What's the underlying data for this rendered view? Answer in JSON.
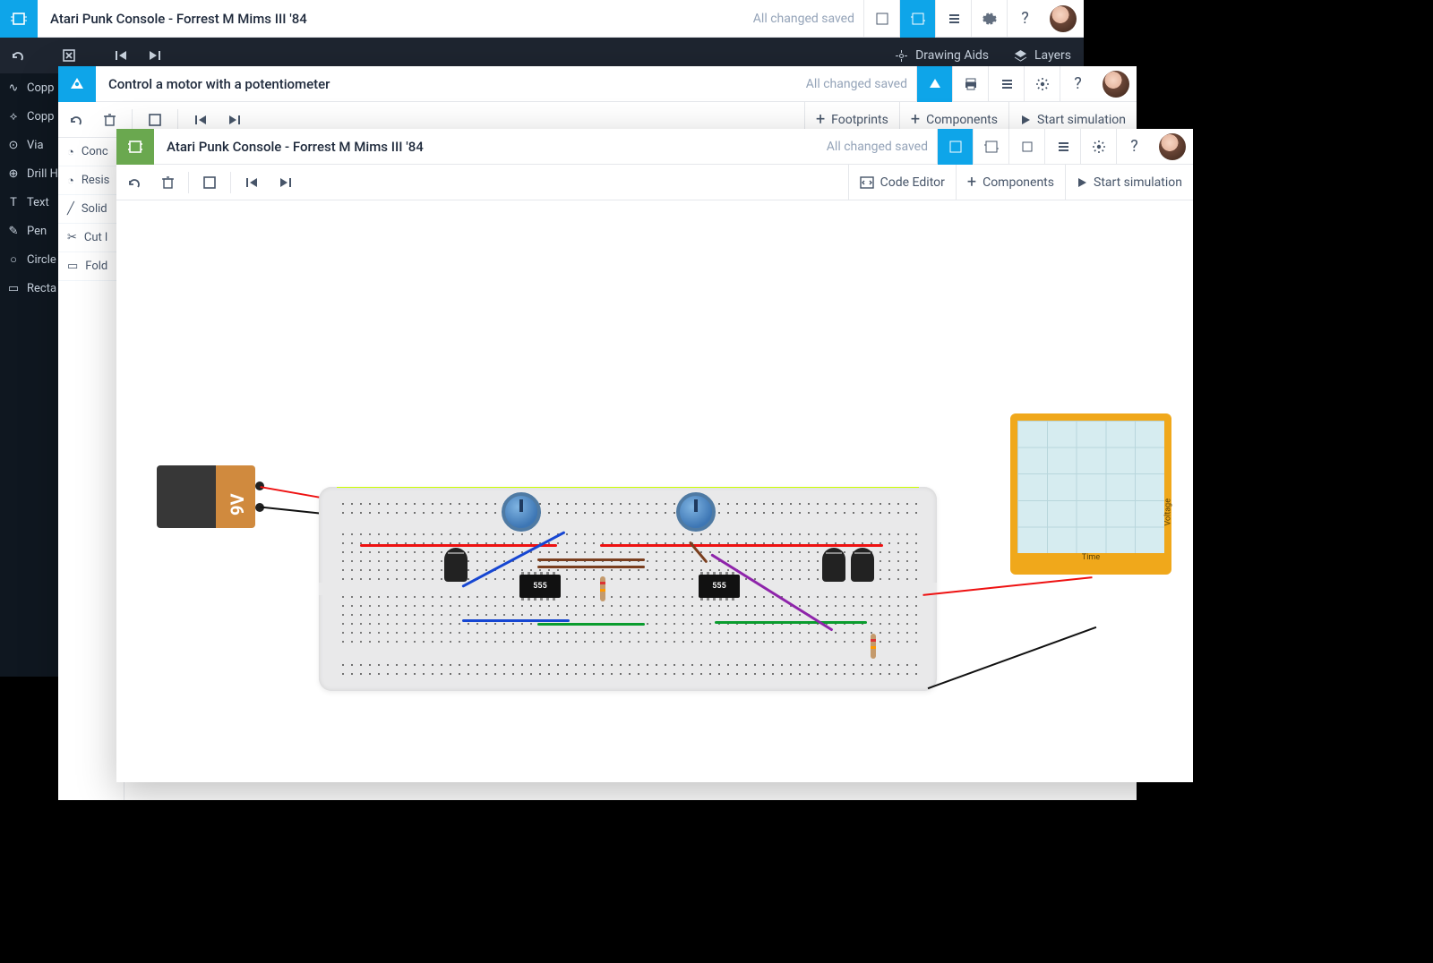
{
  "win1": {
    "title": "Atari Punk Console - Forrest M Mims III '84",
    "saved": "All changed saved",
    "actionbar": {
      "drawing_aids": "Drawing Aids",
      "layers": "Layers"
    },
    "sidebar": [
      {
        "icon": "trace",
        "label": "Copp"
      },
      {
        "icon": "trace-dashed",
        "label": "Copp"
      },
      {
        "icon": "via",
        "label": "Via"
      },
      {
        "icon": "drill",
        "label": "Drill H"
      },
      {
        "icon": "text",
        "label": "Text"
      },
      {
        "icon": "pen",
        "label": "Pen"
      },
      {
        "icon": "circle",
        "label": "Circle"
      },
      {
        "icon": "rect",
        "label": "Recta"
      }
    ]
  },
  "win2": {
    "title": "Control a motor with a potentiometer",
    "saved": "All changed saved",
    "actionbar": {
      "footprints": "Footprints",
      "components": "Components",
      "start_sim": "Start simulation"
    },
    "sidebar": [
      {
        "icon": "cond",
        "label": "Conc"
      },
      {
        "icon": "resist",
        "label": "Resis"
      },
      {
        "icon": "solid",
        "label": "Solid"
      },
      {
        "icon": "cut",
        "label": "Cut l"
      },
      {
        "icon": "fold",
        "label": "Fold"
      }
    ]
  },
  "win3": {
    "title": "Atari Punk Console - Forrest M Mims III '84",
    "saved": "All changed saved",
    "actionbar": {
      "code_editor": "Code Editor",
      "components": "Components",
      "start_sim": "Start simulation"
    },
    "battery": {
      "label": "9V"
    },
    "chips": {
      "chip1": "555",
      "chip2": "555"
    },
    "scope": {
      "xlabel": "Time",
      "ylabel": "Voltage"
    }
  }
}
